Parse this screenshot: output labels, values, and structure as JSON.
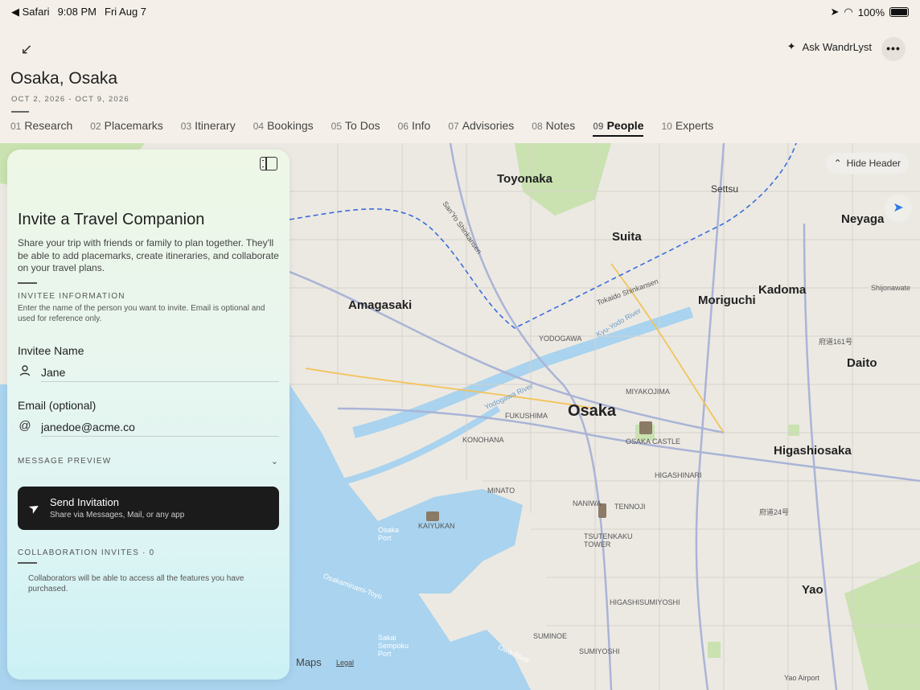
{
  "status_bar": {
    "app": "Safari",
    "time": "9:08 PM",
    "date": "Fri Aug 7",
    "battery": "100%"
  },
  "header": {
    "ask_label": "Ask WandrLyst",
    "trip_title": "Osaka, Osaka",
    "trip_dates": "OCT 2, 2026 - OCT 9, 2026",
    "tabs": [
      {
        "num": "01",
        "label": "Research"
      },
      {
        "num": "02",
        "label": "Placemarks"
      },
      {
        "num": "03",
        "label": "Itinerary"
      },
      {
        "num": "04",
        "label": "Bookings"
      },
      {
        "num": "05",
        "label": "To Dos"
      },
      {
        "num": "06",
        "label": "Info"
      },
      {
        "num": "07",
        "label": "Advisories"
      },
      {
        "num": "08",
        "label": "Notes"
      },
      {
        "num": "09",
        "label": "People",
        "active": true
      },
      {
        "num": "10",
        "label": "Experts"
      }
    ]
  },
  "map": {
    "hide_header_label": "Hide Header",
    "brand": "Maps",
    "legal": "Legal",
    "labels": {
      "toyonaka": "Toyonaka",
      "settsu": "Settsu",
      "neyaga": "Neyaga",
      "suita": "Suita",
      "amagasaki": "Amagasaki",
      "kadoma": "Kadoma",
      "moriguchi": "Moriguchi",
      "shijonawate": "Shijonawate",
      "yodogawa": "YODOGAWA",
      "daito": "Daito",
      "miyakojima": "MIYAKOJIMA",
      "fukushima": "FUKUSHIMA",
      "osaka": "Osaka",
      "konohana": "KONOHANA",
      "osaka_castle": "OSAKA CASTLE",
      "higashiosaka": "Higashiosaka",
      "higashinari": "HIGASHINARI",
      "minato": "MINATO",
      "naniwa": "NANIWA",
      "tennoji": "TENNOJI",
      "kaiyukan": "KAIYUKAN",
      "tsutenkaku": "TSUTENKAKU TOWER",
      "higashisumiyoshi": "HIGASHISUMIYOSHI",
      "yao": "Yao",
      "suminoe": "SUMINOE",
      "sumiyoshi": "SUMIYOSHI",
      "yao_airport": "Yao Airport",
      "osaka_port": "Osaka Port",
      "sakai_port": "Sakai Sempoku Port",
      "yodogawa_river": "Yodogawa River",
      "shinkansen": "Tokaido Shinkansen",
      "sanyo": "San'Yo Shinkansen",
      "kyu_yodo": "Kyu-Yodo River",
      "osakaminato": "Osakaminami-Toyo",
      "owa_river": "Owa-River",
      "route_ja": "府道161号",
      "route_ja2": "府道24号"
    }
  },
  "panel": {
    "title": "Invite a Travel Companion",
    "description": "Share your trip with friends or family to plan together. They'll be able to add placemarks, create itineraries, and collaborate on your travel plans.",
    "invitee_section": "INVITEE INFORMATION",
    "invitee_help": "Enter the name of the person you want to invite. Email is optional and used for reference only.",
    "name_label": "Invitee Name",
    "name_value": "Jane",
    "email_label": "Email (optional)",
    "email_value": "janedoe@acme.co",
    "message_preview": "MESSAGE PREVIEW",
    "send_title": "Send Invitation",
    "send_sub": "Share via Messages, Mail, or any app",
    "collab_section": "COLLABORATION INVITES · 0",
    "collab_note": "Collaborators will be able to access all the features you have purchased."
  }
}
